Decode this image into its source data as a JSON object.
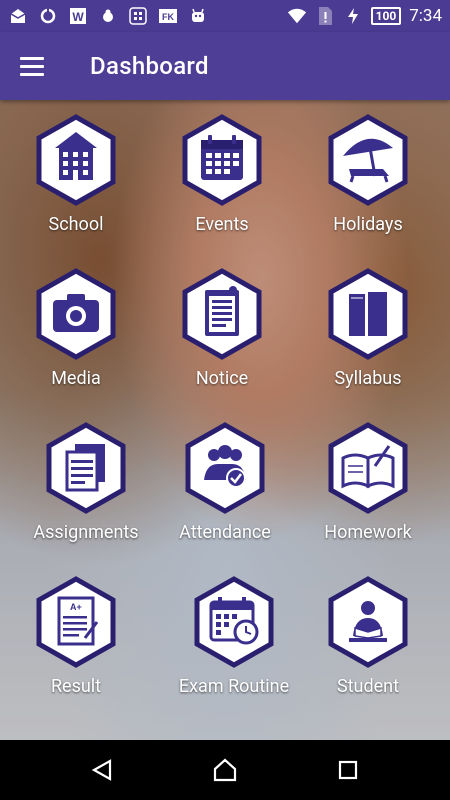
{
  "status_bar": {
    "battery": "100",
    "time": "7:34",
    "icons": [
      "mail-icon",
      "sync-icon",
      "w-app-icon",
      "bug-icon",
      "grid-app-icon",
      "fk-app-icon",
      "android-icon",
      "wifi-icon",
      "sim-alert-icon",
      "charging-icon"
    ]
  },
  "app_bar": {
    "title": "Dashboard",
    "menu_icon": "hamburger-menu-icon"
  },
  "colors": {
    "primary": "#4f3e96",
    "icon_purple": "#3a2f8c",
    "hex_border": "#2a1f6e"
  },
  "dashboard": {
    "tiles": [
      {
        "label": "School",
        "icon": "school-building-icon"
      },
      {
        "label": "Events",
        "icon": "calendar-icon"
      },
      {
        "label": "Holidays",
        "icon": "beach-umbrella-icon"
      },
      {
        "label": "Media",
        "icon": "camera-icon"
      },
      {
        "label": "Notice",
        "icon": "notice-clipboard-icon"
      },
      {
        "label": "Syllabus",
        "icon": "books-icon"
      },
      {
        "label": "Assignments",
        "icon": "assignment-papers-icon"
      },
      {
        "label": "Attendance",
        "icon": "group-check-icon"
      },
      {
        "label": "Homework",
        "icon": "open-book-pen-icon"
      },
      {
        "label": "Result",
        "icon": "result-sheet-icon"
      },
      {
        "label": "Exam Routine",
        "icon": "calendar-clock-icon"
      },
      {
        "label": "Student",
        "icon": "student-reading-icon"
      }
    ]
  },
  "nav_bar": {
    "back_icon": "back-triangle-icon",
    "home_icon": "home-icon",
    "recents_icon": "recents-square-icon"
  }
}
